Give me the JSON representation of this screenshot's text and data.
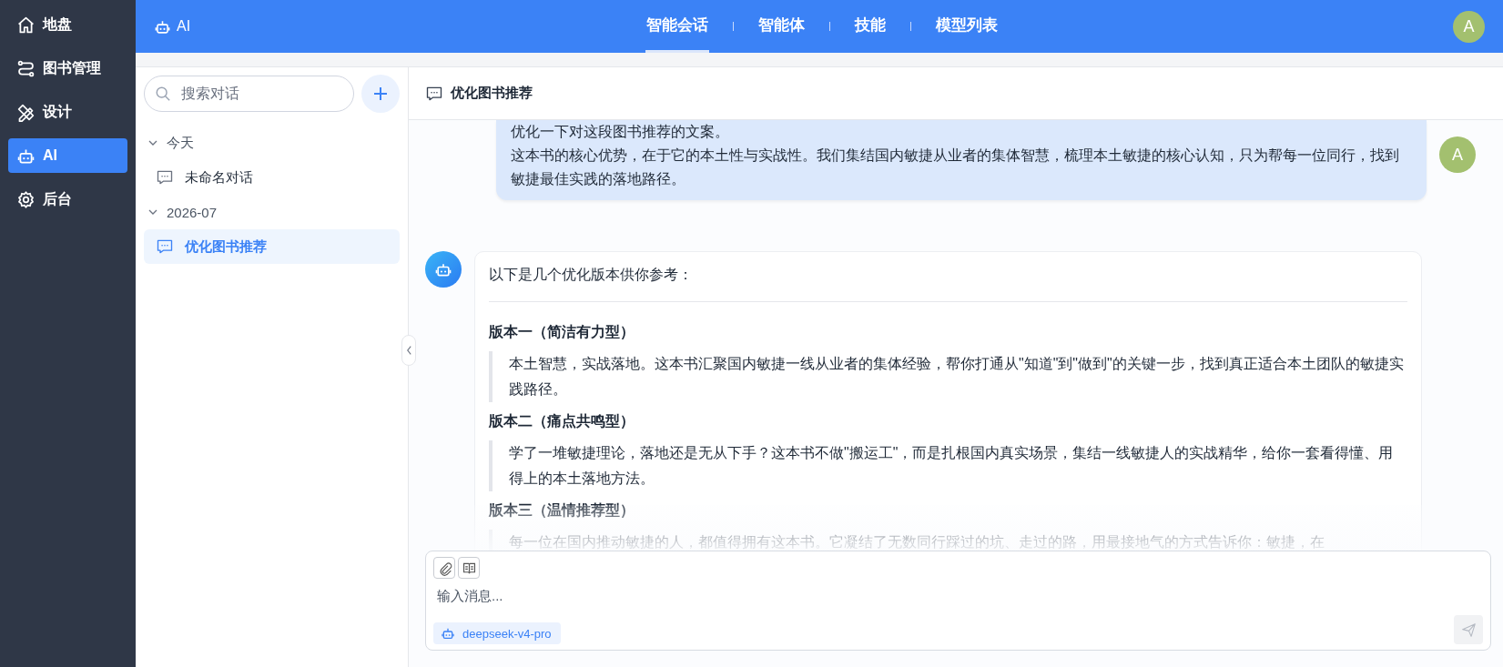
{
  "sidebar": {
    "items": [
      {
        "label": "地盘",
        "selected": false
      },
      {
        "label": "图书管理",
        "selected": false
      },
      {
        "label": "设计",
        "selected": false
      },
      {
        "label": "AI",
        "selected": true
      },
      {
        "label": "后台",
        "selected": false
      }
    ]
  },
  "topbar": {
    "app_label": "AI",
    "tabs": [
      {
        "label": "智能会话",
        "selected": true
      },
      {
        "label": "智能体",
        "selected": false
      },
      {
        "label": "技能",
        "selected": false
      },
      {
        "label": "模型列表",
        "selected": false
      }
    ],
    "avatar": "A"
  },
  "conversations": {
    "search": {
      "placeholder": "搜索对话"
    },
    "groups": [
      {
        "label": "今天",
        "expanded": true,
        "items": [
          {
            "title": "未命名对话",
            "selected": false
          }
        ]
      },
      {
        "label": "2026-07",
        "expanded": true,
        "items": [
          {
            "title": "优化图书推荐",
            "selected": true
          }
        ]
      }
    ]
  },
  "chat": {
    "title": "优化图书推荐",
    "messages": [
      {
        "kind": "user",
        "avatar": "A",
        "lines": [
          "优化一下对这段图书推荐的文案。",
          "这本书的核心优势，在于它的本土性与实战性。我们集结国内敏捷从业者的集体智慧，梳理本土敏捷的核心认知，只为帮每一位同行，找到敏捷最佳实践的落地路径。"
        ]
      },
      {
        "kind": "assistant",
        "intro": "以下是几个优化版本供你参考：",
        "sections": [
          {
            "heading": "版本一（简洁有力型）",
            "quote": "本土智慧，实战落地。这本书汇聚国内敏捷一线从业者的集体经验，帮你打通从\"知道\"到\"做到\"的关键一步，找到真正适合本土团队的敏捷实践路径。"
          },
          {
            "heading": "版本二（痛点共鸣型）",
            "quote": "学了一堆敏捷理论，落地还是无从下手？这本书不做\"搬运工\"，而是扎根国内真实场景，集结一线敏捷人的实战精华，给你一套看得懂、用得上的本土落地方法。"
          },
          {
            "heading": "版本三（温情推荐型）",
            "quote": "每一位在国内推动敏捷的人，都值得拥有这本书。它凝结了无数同行踩过的坑、走过的路，用最接地气的方式告诉你：敏捷，在"
          }
        ]
      }
    ],
    "input": {
      "placeholder": "输入消息...",
      "model": "deepseek-v4-pro",
      "send_disabled": true
    }
  }
}
